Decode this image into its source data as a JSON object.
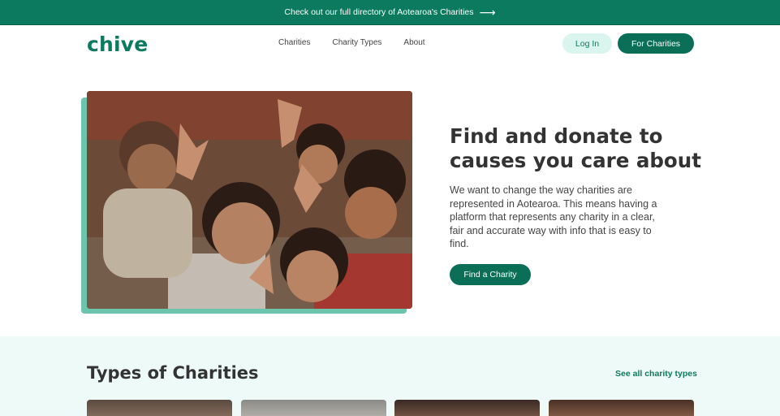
{
  "banner": {
    "text": "Check out our full directory of Aotearoa's Charities",
    "arrow_icon": "arrow-right-icon",
    "arrow_glyph": "⟶"
  },
  "nav": {
    "logo": "chive",
    "links": [
      "Charities",
      "Charity Types",
      "About"
    ],
    "login_label": "Log In",
    "for_charities_label": "For Charities"
  },
  "hero": {
    "title": "Find and donate to causes you care about",
    "description": "We want to change the way charities are represented in Aotearoa. This means having a platform that represents any charity in a clear, fair and accurate way with info that is easy to find.",
    "button_label": "Find a Charity"
  },
  "types": {
    "title": "Types of Charities",
    "see_all_label": "See all charity types"
  },
  "colors": {
    "brand": "#0b7a5e",
    "brand_dark": "#0b6f57",
    "login_bg": "#d9f5ee",
    "photo_shadow": "#6cc4ad",
    "section_bg": "#eefaf8"
  }
}
